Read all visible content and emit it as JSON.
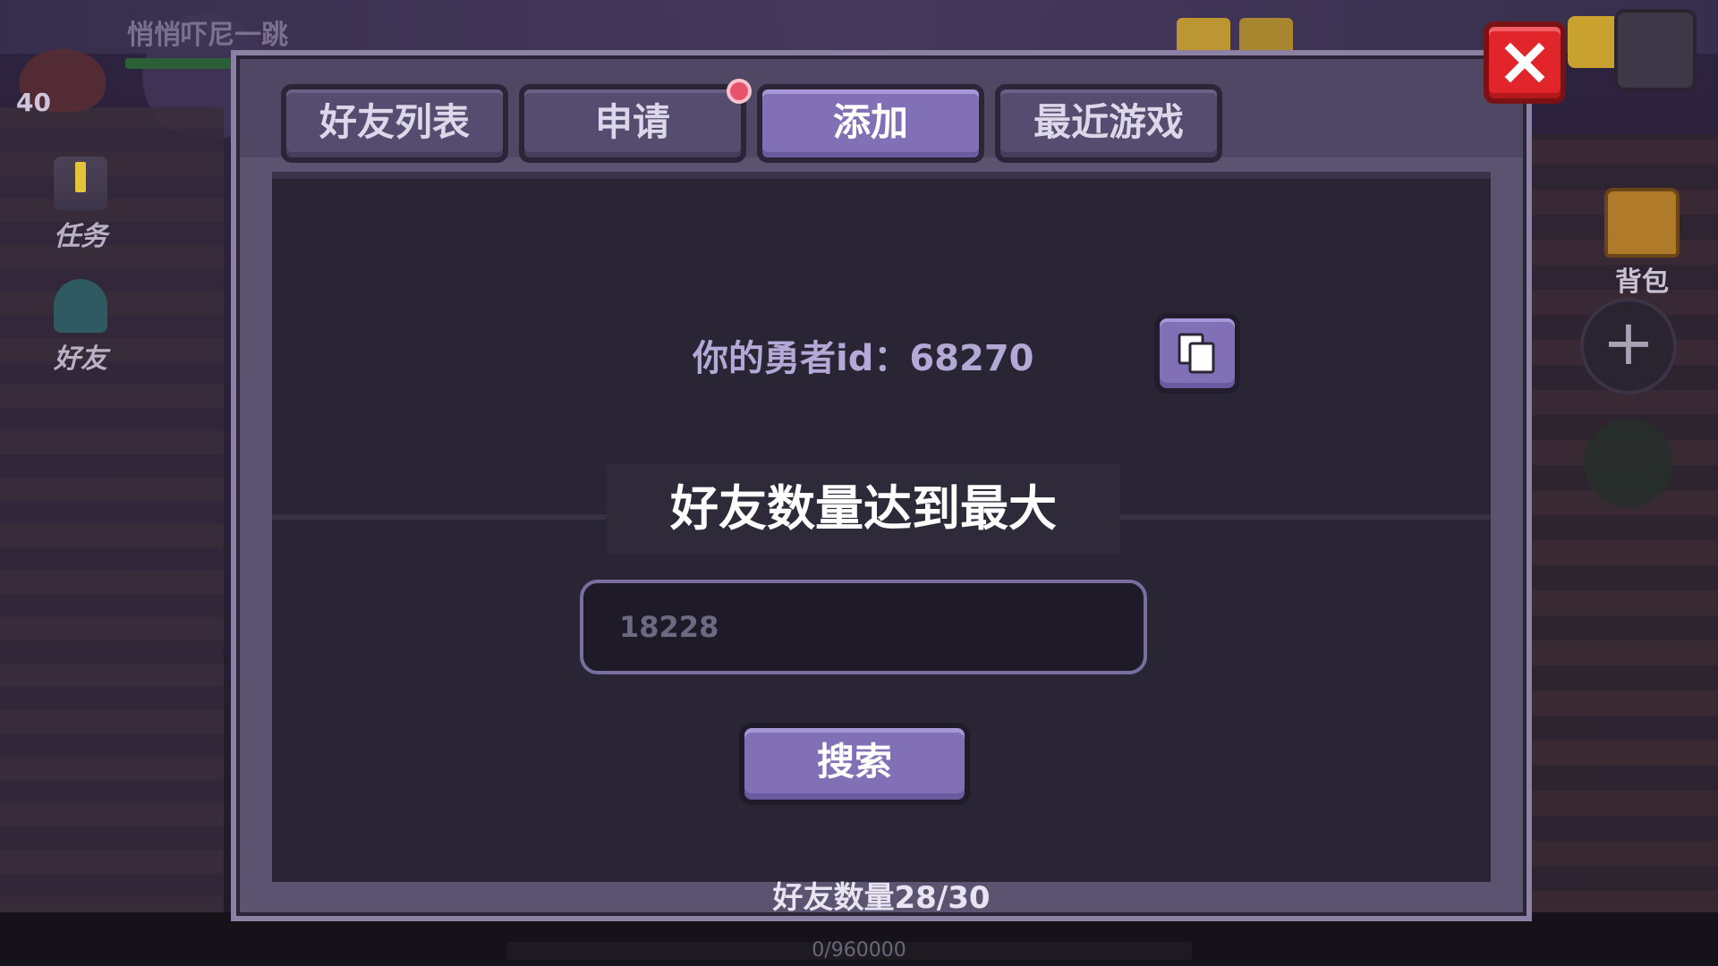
{
  "background": {
    "player_name": "悄悄吓尼一跳",
    "player_level": "40",
    "side_buttons": [
      "任务",
      "好友"
    ],
    "right_buttons": [
      "背包"
    ],
    "exp_text": "0/960000"
  },
  "dialog": {
    "tabs": [
      {
        "label": "好友列表",
        "active": false
      },
      {
        "label": "申请",
        "active": false,
        "has_notification": true
      },
      {
        "label": "添加",
        "active": true
      },
      {
        "label": "最近游戏",
        "active": false
      }
    ],
    "id_label": "你的勇者id：68270",
    "copy_icon": "copy-icon",
    "toast": "好友数量达到最大",
    "search": {
      "value": "",
      "placeholder": "18228"
    },
    "search_button": "搜索",
    "friend_count": "好友数量28/30",
    "close_icon": "close-icon"
  },
  "colors": {
    "accent_purple": "#8270b6",
    "panel_bg": "#2a2535",
    "close_red": "#e2242b",
    "notification_red": "#e9526b"
  }
}
